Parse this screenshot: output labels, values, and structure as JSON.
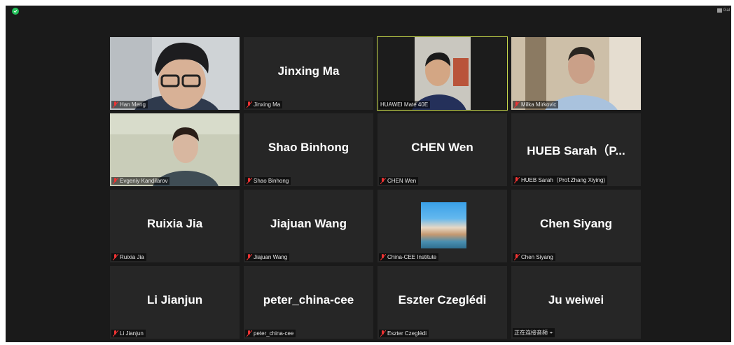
{
  "window": {
    "view_label": "Gal",
    "security_icon": "shield-check-icon",
    "active_border_color": "#c6d84a"
  },
  "participants": [
    {
      "display_name": "",
      "label": "Han Meng",
      "video": "person",
      "muted": true
    },
    {
      "display_name": "Jinxing Ma",
      "label": "Jinxing Ma",
      "video": "off",
      "muted": true
    },
    {
      "display_name": "",
      "label": "HUAWEI Mate 40E",
      "video": "person",
      "muted": false,
      "active_speaker": true
    },
    {
      "display_name": "",
      "label": "Milka Mirkovic",
      "video": "person",
      "muted": true
    },
    {
      "display_name": "",
      "label": "Evgeniy Kandilarov",
      "video": "person",
      "muted": true
    },
    {
      "display_name": "Shao Binhong",
      "label": "Shao Binhong",
      "video": "off",
      "muted": true
    },
    {
      "display_name": "CHEN Wen",
      "label": "CHEN Wen",
      "video": "off",
      "muted": true
    },
    {
      "display_name": "HUEB Sarah（P...",
      "label": "HUEB Sarah（Prof.Zhang Xiying)",
      "video": "off",
      "muted": true
    },
    {
      "display_name": "Ruixia Jia",
      "label": "Ruixia Jia",
      "video": "off",
      "muted": true
    },
    {
      "display_name": "Jiajuan Wang",
      "label": "Jiajuan Wang",
      "video": "off",
      "muted": true
    },
    {
      "display_name": "",
      "label": "China-CEE Institute",
      "video": "picture",
      "muted": true
    },
    {
      "display_name": "Chen Siyang",
      "label": "Chen Siyang",
      "video": "off",
      "muted": true
    },
    {
      "display_name": "Li Jianjun",
      "label": "Li Jianjun",
      "video": "off",
      "muted": true
    },
    {
      "display_name": "peter_china-cee",
      "label": "peter_china-cee",
      "video": "off",
      "muted": true
    },
    {
      "display_name": "Eszter Czeglédi",
      "label": "Eszter Czeglédi",
      "video": "off",
      "muted": true
    },
    {
      "display_name": "Ju weiwei",
      "label": "正在连接音频",
      "video": "off",
      "muted": false,
      "connecting": true
    }
  ]
}
